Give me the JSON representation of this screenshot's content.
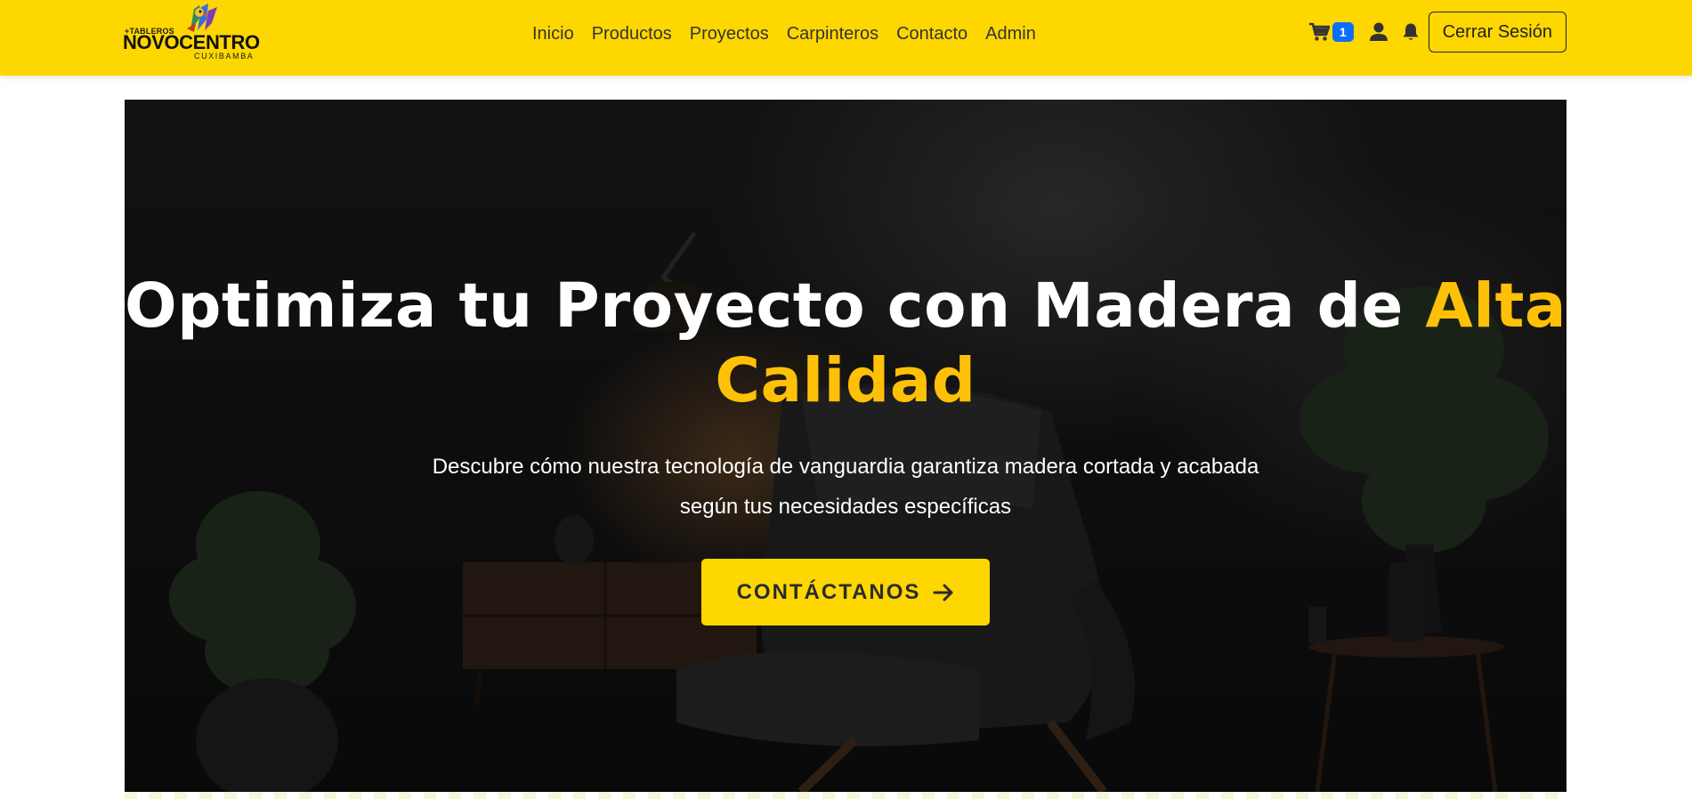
{
  "brand": {
    "top_text": "+TABLEROS",
    "name": "NOVOCENTRO",
    "subtitle": "CUXIBAMBA",
    "logo_icon": "parrot-mascot-icon"
  },
  "nav": {
    "links": [
      "Inicio",
      "Productos",
      "Proyectos",
      "Carpinteros",
      "Contacto",
      "Admin"
    ],
    "cart_icon": "shopping-cart-icon",
    "cart_count": "1",
    "user_icon": "user-icon",
    "bell_icon": "bell-icon",
    "logout_label": "Cerrar Sesión"
  },
  "hero": {
    "title_main": "Optimiza tu Proyecto con Madera de ",
    "title_accent": "Alta Calidad",
    "description": "Descubre cómo nuestra tecnología de vanguardia garantiza madera cortada y acabada según tus necesidades específicas",
    "cta_label": "CONTÁCTANOS",
    "cta_icon": "arrow-right-icon"
  },
  "colors": {
    "brand_yellow": "#FFD700",
    "accent_yellow": "#FFC107",
    "badge_blue": "#0d6efd",
    "hero_dark": "#121212"
  }
}
